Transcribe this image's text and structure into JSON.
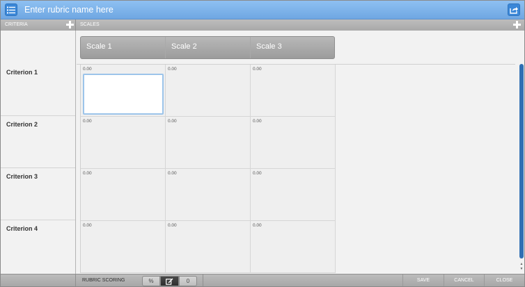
{
  "title_bar": {
    "placeholder": "Enter rubric name here",
    "left_icon": "list-icon",
    "right_icon": "share-icon"
  },
  "headers": {
    "criteria_label": "CRITERIA",
    "scales_label": "SCALES",
    "add_icon": "plus-icon"
  },
  "scales": [
    {
      "label": "Scale 1"
    },
    {
      "label": "Scale 2"
    },
    {
      "label": "Scale 3"
    }
  ],
  "criteria": [
    {
      "label": "Criterion 1",
      "points": [
        "0.00",
        "0.00",
        "0.00"
      ]
    },
    {
      "label": "Criterion 2",
      "points": [
        "0.00",
        "0.00",
        "0.00"
      ]
    },
    {
      "label": "Criterion 3",
      "points": [
        "0.00",
        "0.00",
        "0.00"
      ]
    },
    {
      "label": "Criterion 4",
      "points": [
        "0.00",
        "0.00",
        "0.00"
      ]
    }
  ],
  "footer": {
    "rubric_scoring_label": "RUBRIC SCORING",
    "scoring_modes": [
      {
        "label": "%",
        "icon": "percent"
      },
      {
        "label": "",
        "icon": "edit-icon",
        "selected": true
      },
      {
        "label": "0",
        "icon": "zero"
      }
    ],
    "save_label": "SAVE",
    "cancel_label": "CANCEL",
    "close_label": "CLOSE"
  },
  "colors": {
    "title_bar": "#7fb4ea",
    "accent": "#3a87d8",
    "scrollbar": "#2f6fb3",
    "active_cell_border": "#9cc4ea"
  }
}
